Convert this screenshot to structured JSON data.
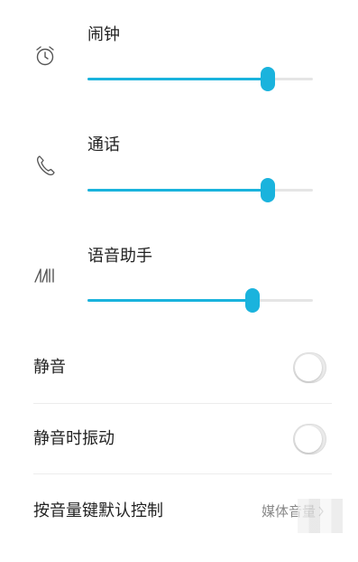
{
  "sliders": [
    {
      "icon": "alarm-clock-icon",
      "label": "闹钟",
      "level": 0.8
    },
    {
      "icon": "phone-icon",
      "label": "通话",
      "level": 0.8
    },
    {
      "icon": "voice-assistant-icon",
      "label": "语音助手",
      "level": 0.73
    }
  ],
  "settings": {
    "mute": {
      "label": "静音",
      "enabled": false
    },
    "vibrate_on_mute": {
      "label": "静音时振动",
      "enabled": false
    },
    "volume_key": {
      "label": "按音量键默认控制",
      "value": "媒体音量"
    }
  },
  "colors": {
    "accent": "#1ab3dd",
    "track": "#e5e5e5",
    "toggle_off": "#eaeaea"
  }
}
